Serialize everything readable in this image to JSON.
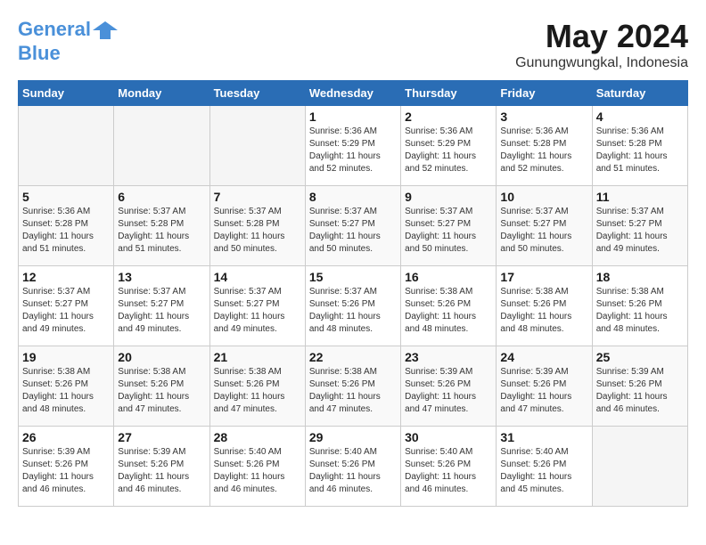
{
  "logo": {
    "line1": "General",
    "line2": "Blue"
  },
  "title": "May 2024",
  "subtitle": "Gunungwungkal, Indonesia",
  "days_of_week": [
    "Sunday",
    "Monday",
    "Tuesday",
    "Wednesday",
    "Thursday",
    "Friday",
    "Saturday"
  ],
  "weeks": [
    [
      {
        "day": "",
        "info": ""
      },
      {
        "day": "",
        "info": ""
      },
      {
        "day": "",
        "info": ""
      },
      {
        "day": "1",
        "info": "Sunrise: 5:36 AM\nSunset: 5:29 PM\nDaylight: 11 hours\nand 52 minutes."
      },
      {
        "day": "2",
        "info": "Sunrise: 5:36 AM\nSunset: 5:29 PM\nDaylight: 11 hours\nand 52 minutes."
      },
      {
        "day": "3",
        "info": "Sunrise: 5:36 AM\nSunset: 5:28 PM\nDaylight: 11 hours\nand 52 minutes."
      },
      {
        "day": "4",
        "info": "Sunrise: 5:36 AM\nSunset: 5:28 PM\nDaylight: 11 hours\nand 51 minutes."
      }
    ],
    [
      {
        "day": "5",
        "info": "Sunrise: 5:36 AM\nSunset: 5:28 PM\nDaylight: 11 hours\nand 51 minutes."
      },
      {
        "day": "6",
        "info": "Sunrise: 5:37 AM\nSunset: 5:28 PM\nDaylight: 11 hours\nand 51 minutes."
      },
      {
        "day": "7",
        "info": "Sunrise: 5:37 AM\nSunset: 5:28 PM\nDaylight: 11 hours\nand 50 minutes."
      },
      {
        "day": "8",
        "info": "Sunrise: 5:37 AM\nSunset: 5:27 PM\nDaylight: 11 hours\nand 50 minutes."
      },
      {
        "day": "9",
        "info": "Sunrise: 5:37 AM\nSunset: 5:27 PM\nDaylight: 11 hours\nand 50 minutes."
      },
      {
        "day": "10",
        "info": "Sunrise: 5:37 AM\nSunset: 5:27 PM\nDaylight: 11 hours\nand 50 minutes."
      },
      {
        "day": "11",
        "info": "Sunrise: 5:37 AM\nSunset: 5:27 PM\nDaylight: 11 hours\nand 49 minutes."
      }
    ],
    [
      {
        "day": "12",
        "info": "Sunrise: 5:37 AM\nSunset: 5:27 PM\nDaylight: 11 hours\nand 49 minutes."
      },
      {
        "day": "13",
        "info": "Sunrise: 5:37 AM\nSunset: 5:27 PM\nDaylight: 11 hours\nand 49 minutes."
      },
      {
        "day": "14",
        "info": "Sunrise: 5:37 AM\nSunset: 5:27 PM\nDaylight: 11 hours\nand 49 minutes."
      },
      {
        "day": "15",
        "info": "Sunrise: 5:37 AM\nSunset: 5:26 PM\nDaylight: 11 hours\nand 48 minutes."
      },
      {
        "day": "16",
        "info": "Sunrise: 5:38 AM\nSunset: 5:26 PM\nDaylight: 11 hours\nand 48 minutes."
      },
      {
        "day": "17",
        "info": "Sunrise: 5:38 AM\nSunset: 5:26 PM\nDaylight: 11 hours\nand 48 minutes."
      },
      {
        "day": "18",
        "info": "Sunrise: 5:38 AM\nSunset: 5:26 PM\nDaylight: 11 hours\nand 48 minutes."
      }
    ],
    [
      {
        "day": "19",
        "info": "Sunrise: 5:38 AM\nSunset: 5:26 PM\nDaylight: 11 hours\nand 48 minutes."
      },
      {
        "day": "20",
        "info": "Sunrise: 5:38 AM\nSunset: 5:26 PM\nDaylight: 11 hours\nand 47 minutes."
      },
      {
        "day": "21",
        "info": "Sunrise: 5:38 AM\nSunset: 5:26 PM\nDaylight: 11 hours\nand 47 minutes."
      },
      {
        "day": "22",
        "info": "Sunrise: 5:38 AM\nSunset: 5:26 PM\nDaylight: 11 hours\nand 47 minutes."
      },
      {
        "day": "23",
        "info": "Sunrise: 5:39 AM\nSunset: 5:26 PM\nDaylight: 11 hours\nand 47 minutes."
      },
      {
        "day": "24",
        "info": "Sunrise: 5:39 AM\nSunset: 5:26 PM\nDaylight: 11 hours\nand 47 minutes."
      },
      {
        "day": "25",
        "info": "Sunrise: 5:39 AM\nSunset: 5:26 PM\nDaylight: 11 hours\nand 46 minutes."
      }
    ],
    [
      {
        "day": "26",
        "info": "Sunrise: 5:39 AM\nSunset: 5:26 PM\nDaylight: 11 hours\nand 46 minutes."
      },
      {
        "day": "27",
        "info": "Sunrise: 5:39 AM\nSunset: 5:26 PM\nDaylight: 11 hours\nand 46 minutes."
      },
      {
        "day": "28",
        "info": "Sunrise: 5:40 AM\nSunset: 5:26 PM\nDaylight: 11 hours\nand 46 minutes."
      },
      {
        "day": "29",
        "info": "Sunrise: 5:40 AM\nSunset: 5:26 PM\nDaylight: 11 hours\nand 46 minutes."
      },
      {
        "day": "30",
        "info": "Sunrise: 5:40 AM\nSunset: 5:26 PM\nDaylight: 11 hours\nand 46 minutes."
      },
      {
        "day": "31",
        "info": "Sunrise: 5:40 AM\nSunset: 5:26 PM\nDaylight: 11 hours\nand 45 minutes."
      },
      {
        "day": "",
        "info": ""
      }
    ]
  ]
}
